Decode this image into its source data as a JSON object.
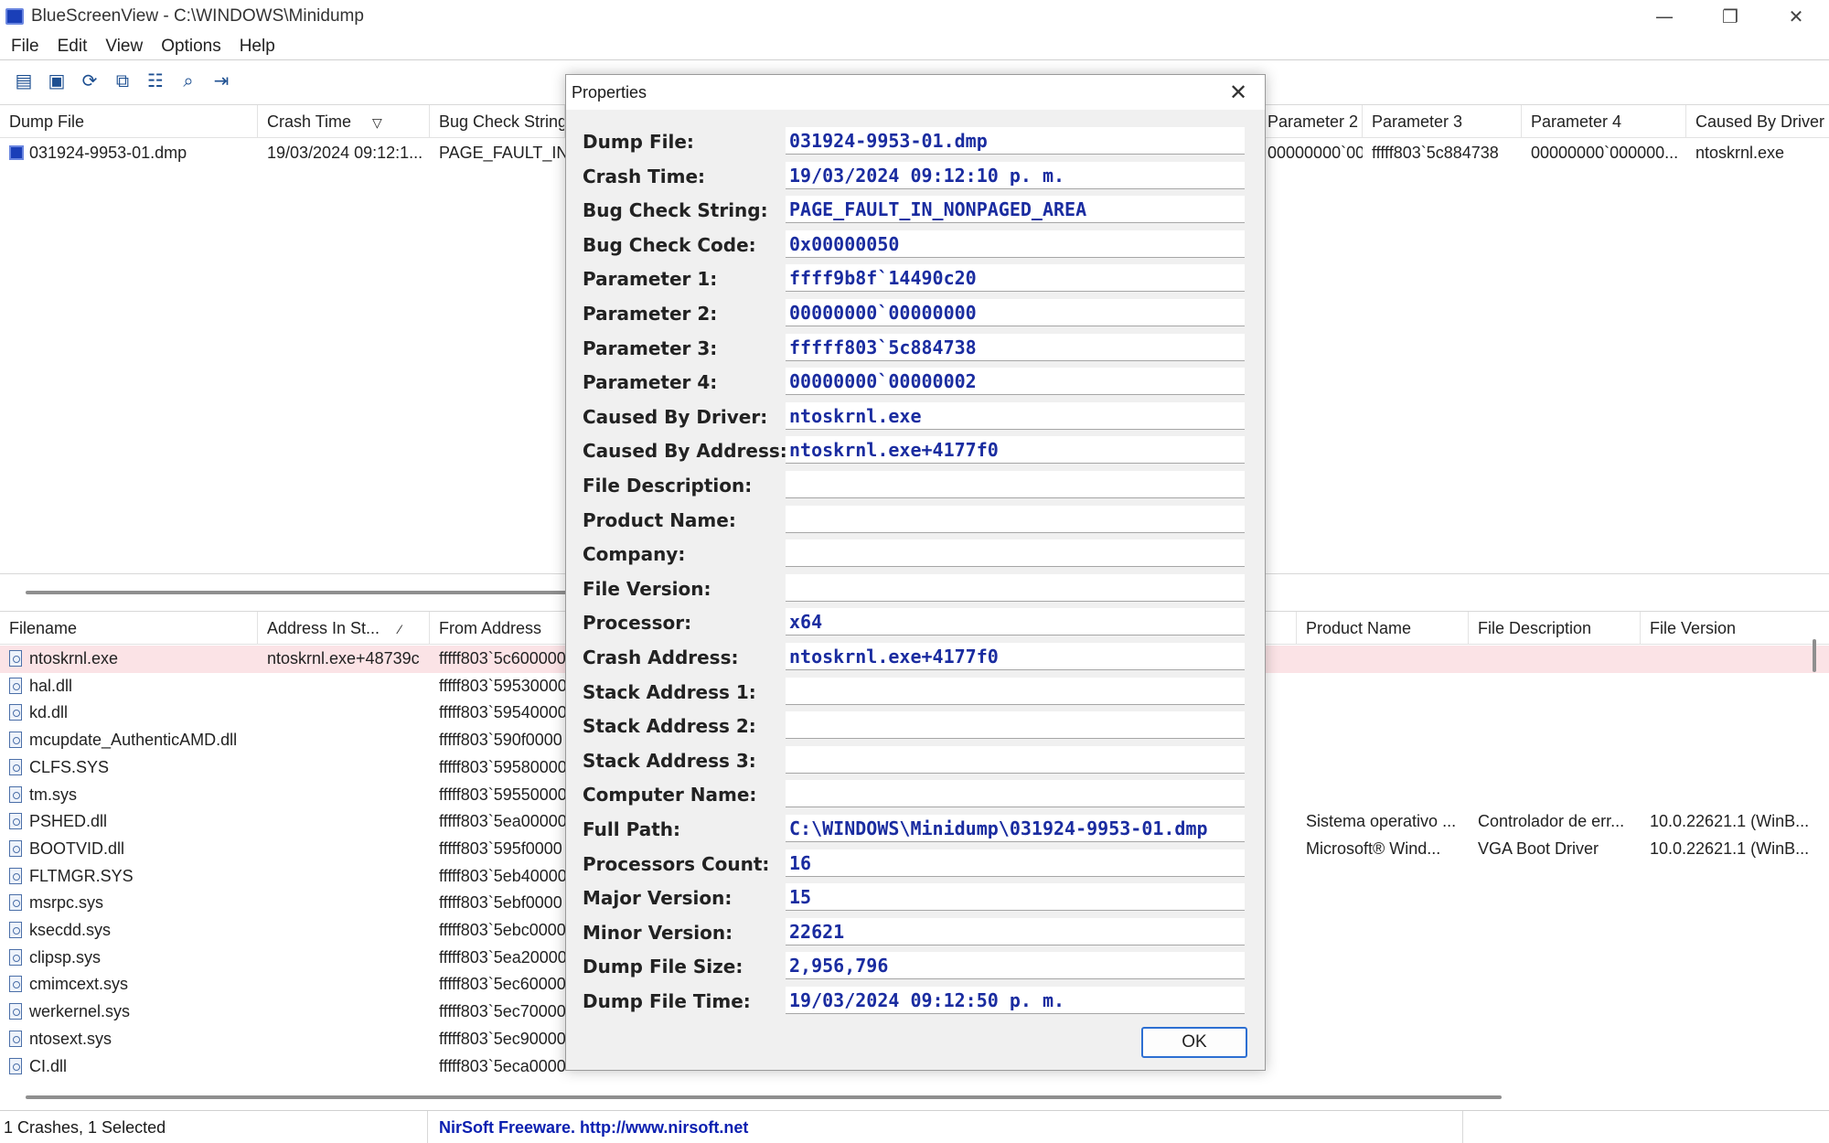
{
  "window": {
    "title": "BlueScreenView  -  C:\\WINDOWS\\Minidump"
  },
  "menu": [
    "File",
    "Edit",
    "View",
    "Options",
    "Help"
  ],
  "upper_list": {
    "columns": [
      "Dump File",
      "Crash Time",
      "Bug Check String",
      "Parameter 2",
      "Parameter 3",
      "Parameter 4",
      "Caused By Driver"
    ],
    "row": {
      "dump_file": "031924-9953-01.dmp",
      "crash_time": "19/03/2024 09:12:1...",
      "bug_check": "PAGE_FAULT_IN_...",
      "param2": "00000000`000000...",
      "param3": "fffff803`5c884738",
      "param4": "00000000`000000...",
      "driver": "ntoskrnl.exe"
    }
  },
  "lower_list": {
    "columns": [
      "Filename",
      "Address In St...",
      "From Address",
      "Product Name",
      "File Description",
      "File Version"
    ],
    "rows": [
      {
        "filename": "ntoskrnl.exe",
        "addr": "ntoskrnl.exe+48739c",
        "from": "fffff803`5c600000",
        "product": "",
        "desc": "",
        "version": ""
      },
      {
        "filename": "hal.dll",
        "addr": "",
        "from": "fffff803`59530000",
        "product": "",
        "desc": "",
        "version": ""
      },
      {
        "filename": "kd.dll",
        "addr": "",
        "from": "fffff803`59540000",
        "product": "",
        "desc": "",
        "version": ""
      },
      {
        "filename": "mcupdate_AuthenticAMD.dll",
        "addr": "",
        "from": "fffff803`590f0000",
        "product": "",
        "desc": "",
        "version": ""
      },
      {
        "filename": "CLFS.SYS",
        "addr": "",
        "from": "fffff803`59580000",
        "product": "",
        "desc": "",
        "version": ""
      },
      {
        "filename": "tm.sys",
        "addr": "",
        "from": "fffff803`59550000",
        "product": "",
        "desc": "",
        "version": ""
      },
      {
        "filename": "PSHED.dll",
        "addr": "",
        "from": "fffff803`5ea00000",
        "product": "Sistema operativo ...",
        "desc": "Controlador de err...",
        "version": "10.0.22621.1 (WinB..."
      },
      {
        "filename": "BOOTVID.dll",
        "addr": "",
        "from": "fffff803`595f0000",
        "product": "Microsoft® Wind...",
        "desc": "VGA Boot Driver",
        "version": "10.0.22621.1 (WinB..."
      },
      {
        "filename": "FLTMGR.SYS",
        "addr": "",
        "from": "fffff803`5eb40000",
        "product": "",
        "desc": "",
        "version": ""
      },
      {
        "filename": "msrpc.sys",
        "addr": "",
        "from": "fffff803`5ebf0000",
        "product": "",
        "desc": "",
        "version": ""
      },
      {
        "filename": "ksecdd.sys",
        "addr": "",
        "from": "fffff803`5ebc0000",
        "product": "",
        "desc": "",
        "version": ""
      },
      {
        "filename": "clipsp.sys",
        "addr": "",
        "from": "fffff803`5ea20000",
        "product": "",
        "desc": "",
        "version": ""
      },
      {
        "filename": "cmimcext.sys",
        "addr": "",
        "from": "fffff803`5ec60000",
        "product": "",
        "desc": "",
        "version": ""
      },
      {
        "filename": "werkernel.sys",
        "addr": "",
        "from": "fffff803`5ec70000",
        "product": "",
        "desc": "",
        "version": ""
      },
      {
        "filename": "ntosext.sys",
        "addr": "",
        "from": "fffff803`5ec90000",
        "product": "",
        "desc": "",
        "version": ""
      },
      {
        "filename": "CI.dll",
        "addr": "",
        "from": "fffff803`5eca0000",
        "product": "",
        "desc": "",
        "version": ""
      }
    ]
  },
  "status": {
    "left": "1 Crashes, 1 Selected",
    "link": "NirSoft Freeware.  http://www.nirsoft.net"
  },
  "dialog": {
    "title": "Properties",
    "ok_label": "OK",
    "fields": [
      {
        "label": "Dump File:",
        "value": "031924-9953-01.dmp"
      },
      {
        "label": "Crash Time:",
        "value": "19/03/2024 09:12:10 p. m."
      },
      {
        "label": "Bug Check String:",
        "value": "PAGE_FAULT_IN_NONPAGED_AREA"
      },
      {
        "label": "Bug Check Code:",
        "value": "0x00000050"
      },
      {
        "label": "Parameter 1:",
        "value": "ffff9b8f`14490c20"
      },
      {
        "label": "Parameter 2:",
        "value": "00000000`00000000"
      },
      {
        "label": "Parameter 3:",
        "value": "fffff803`5c884738"
      },
      {
        "label": "Parameter 4:",
        "value": "00000000`00000002"
      },
      {
        "label": "Caused By Driver:",
        "value": "ntoskrnl.exe"
      },
      {
        "label": "Caused By Address:",
        "value": "ntoskrnl.exe+4177f0"
      },
      {
        "label": "File Description:",
        "value": ""
      },
      {
        "label": "Product Name:",
        "value": ""
      },
      {
        "label": "Company:",
        "value": ""
      },
      {
        "label": "File Version:",
        "value": ""
      },
      {
        "label": "Processor:",
        "value": "x64"
      },
      {
        "label": "Crash Address:",
        "value": "ntoskrnl.exe+4177f0"
      },
      {
        "label": "Stack Address 1:",
        "value": ""
      },
      {
        "label": "Stack Address 2:",
        "value": ""
      },
      {
        "label": "Stack Address 3:",
        "value": ""
      },
      {
        "label": "Computer Name:",
        "value": ""
      },
      {
        "label": "Full Path:",
        "value": "C:\\WINDOWS\\Minidump\\031924-9953-01.dmp"
      },
      {
        "label": "Processors Count:",
        "value": "16"
      },
      {
        "label": "Major Version:",
        "value": "15"
      },
      {
        "label": "Minor Version:",
        "value": "22621"
      },
      {
        "label": "Dump File Size:",
        "value": "2,956,796"
      },
      {
        "label": "Dump File Time:",
        "value": "19/03/2024 09:12:50 p. m."
      }
    ]
  },
  "colors": {
    "value_text": "#1a2ca0",
    "highlight_row": "#fbe3e6",
    "link": "#0b1fb0"
  }
}
